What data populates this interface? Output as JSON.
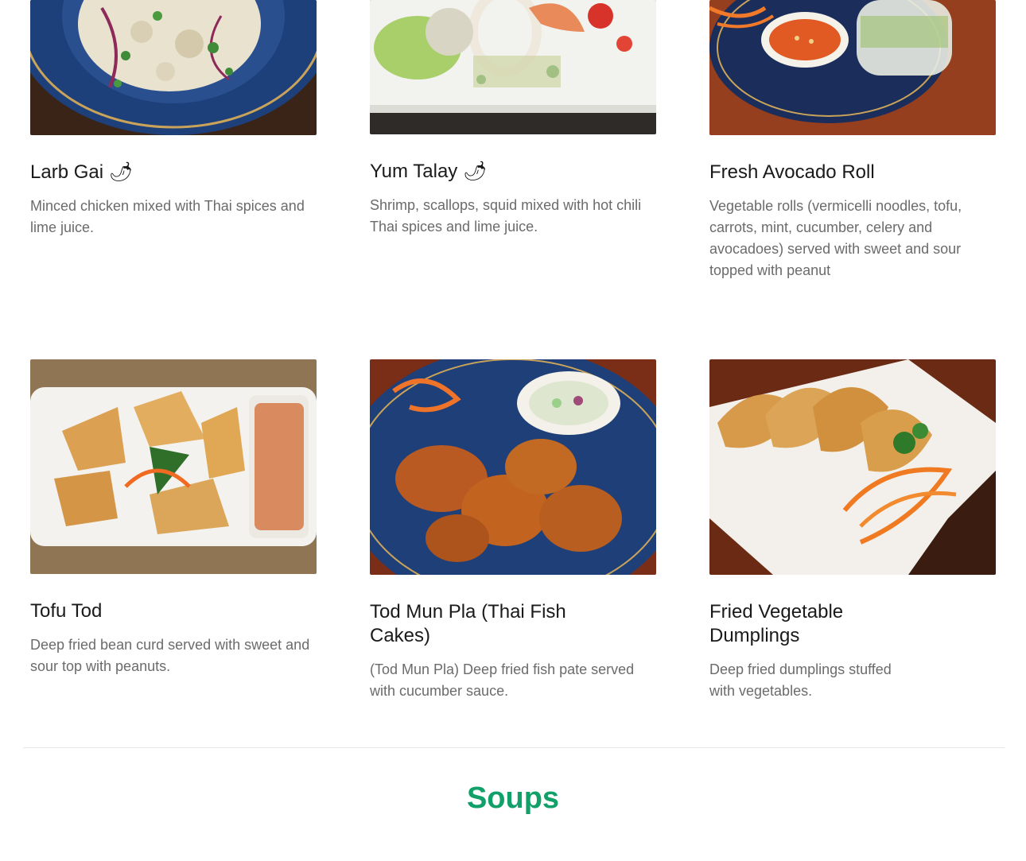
{
  "menu": {
    "items": [
      {
        "name": "Larb Gai",
        "spice_glyph": "🌶",
        "description": "Minced chicken mixed with Thai spices and lime juice.",
        "image": "larb-gai-photo"
      },
      {
        "name": "Yum Talay",
        "spice_glyph": "🌶",
        "description": "Shrimp, scallops, squid mixed with hot chili Thai spices and lime juice.",
        "image": "yum-talay-photo"
      },
      {
        "name": "Fresh Avocado Roll",
        "spice_glyph": "",
        "description": "Vegetable rolls (vermicelli noodles, tofu, carrots, mint, cucumber, celery and avocadoes) served with sweet and sour topped with peanut",
        "image": "avocado-roll-photo"
      },
      {
        "name": "Tofu Tod",
        "spice_glyph": "",
        "description": "Deep fried bean curd served with sweet and sour top with peanuts.",
        "image": "tofu-tod-photo"
      },
      {
        "name": "Tod Mun Pla (Thai Fish Cakes)",
        "spice_glyph": "",
        "description": "(Tod Mun Pla) Deep fried fish pate served with cucumber sauce.",
        "image": "fish-cakes-photo"
      },
      {
        "name": "Fried Vegetable Dumplings",
        "spice_glyph": "",
        "description": "Deep fried dumplings stuffed with vegetables.",
        "image": "dumplings-photo"
      }
    ]
  },
  "next_section": {
    "title": "Soups"
  },
  "colors": {
    "accent": "#11a06a",
    "title": "#1a1a1a",
    "description": "#6b6b6b",
    "divider": "#e6e6e6"
  }
}
